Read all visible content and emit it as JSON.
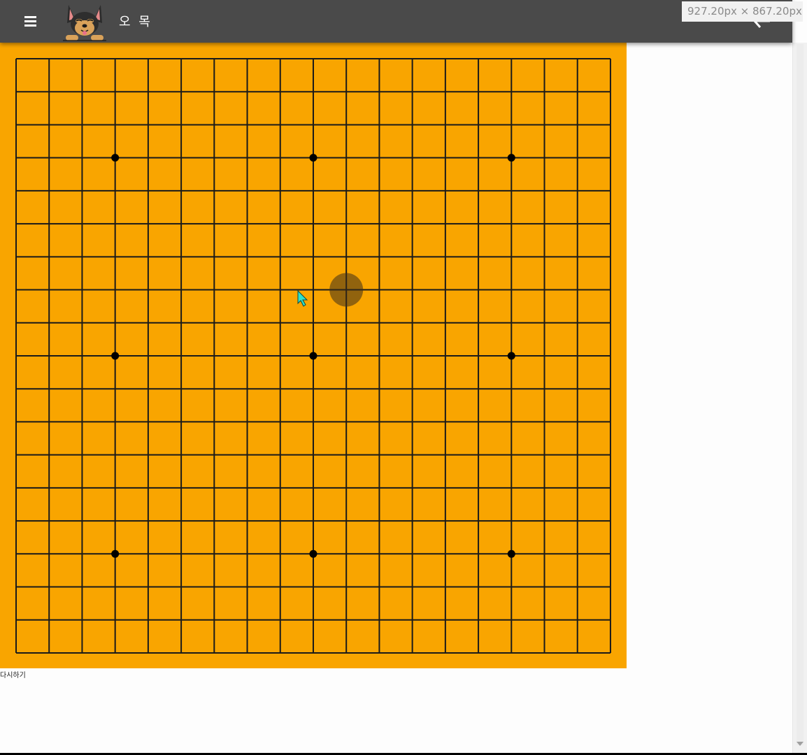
{
  "header": {
    "title": "오 목",
    "menu_icon": "hamburger-menu-icon",
    "logo_icon": "puppy-logo-icon",
    "back_icon": "back-arrow-icon",
    "bar_color": "#4a4a4a"
  },
  "devtools_overlay": {
    "dimensions": "927.20px × 867.20px"
  },
  "board": {
    "grid_size": 19,
    "board_color": "#f9a500",
    "line_color": "#1a1a1a",
    "star_points": [
      [
        3,
        3
      ],
      [
        3,
        9
      ],
      [
        3,
        15
      ],
      [
        9,
        3
      ],
      [
        9,
        9
      ],
      [
        9,
        15
      ],
      [
        15,
        3
      ],
      [
        15,
        9
      ],
      [
        15,
        15
      ]
    ],
    "hover_stone": {
      "row": 7,
      "col": 10
    }
  },
  "controls": {
    "restart_label": "다시하기"
  }
}
